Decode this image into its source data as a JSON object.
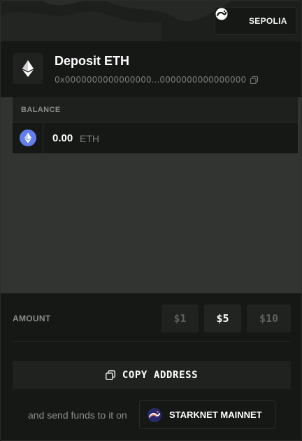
{
  "network": {
    "label": "SEPOLIA",
    "icon": "starknet-icon"
  },
  "header": {
    "title": "Deposit ETH",
    "address": "0x0000000000000000...0000000000000000",
    "token_icon": "ethereum-icon"
  },
  "balance": {
    "heading": "BALANCE",
    "value": "0.00",
    "unit": "ETH"
  },
  "amount": {
    "label": "AMOUNT",
    "options": [
      "$1",
      "$5",
      "$10"
    ],
    "selected": "$5"
  },
  "actions": {
    "copy_label": "COPY ADDRESS",
    "send_text": "and send funds to it on",
    "mainnet_label": "STARKNET MAINNET"
  },
  "colors": {
    "background": "#161816",
    "balance_area": "#323432",
    "eth_blue": "#627eea",
    "starknet_red": "#ec796b",
    "starknet_navy": "#29296e"
  }
}
